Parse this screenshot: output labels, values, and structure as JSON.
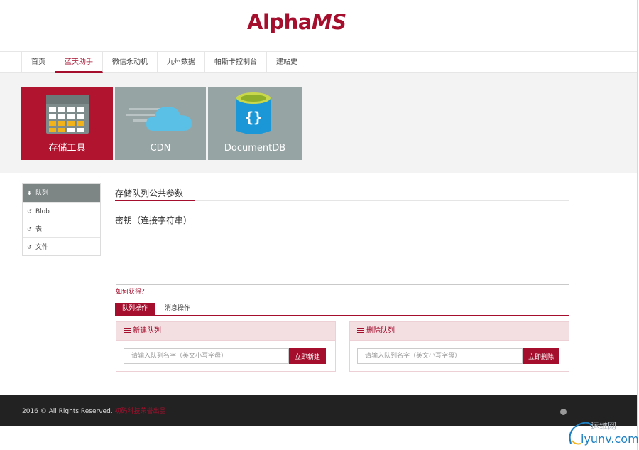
{
  "brand": {
    "name_a": "Alpha",
    "name_b": "MS"
  },
  "nav": {
    "items": [
      {
        "label": "首页"
      },
      {
        "label": "蓝天助手"
      },
      {
        "label": "微信永动机"
      },
      {
        "label": "九州数据"
      },
      {
        "label": "帕斯卡控制台"
      },
      {
        "label": "建站史"
      }
    ],
    "active": "蓝天助手"
  },
  "tiles": [
    {
      "label": "存储工具",
      "icon": "table-icon"
    },
    {
      "label": "CDN",
      "icon": "cloud-icon"
    },
    {
      "label": "DocumentDB",
      "icon": "database-icon"
    }
  ],
  "sidebar": {
    "items": [
      {
        "label": "队列",
        "icon": "download-icon"
      },
      {
        "label": "Blob",
        "icon": "refresh-icon"
      },
      {
        "label": "表",
        "icon": "refresh-icon"
      },
      {
        "label": "文件",
        "icon": "refresh-icon"
      }
    ]
  },
  "main": {
    "section_title": "存储队列公共参数",
    "key_label": "密钥（连接字符串）",
    "key_value": "",
    "howto": "如何获得？",
    "tabs": [
      {
        "label": "队列操作"
      },
      {
        "label": "消息操作"
      }
    ],
    "create_panel": {
      "title": "新建队列",
      "placeholder": "请输入队列名字（英文小写字母）",
      "button": "立即新建"
    },
    "delete_panel": {
      "title": "删除队列",
      "placeholder": "请输入队列名字（英文小写字母）",
      "button": "立即删除"
    }
  },
  "footer": {
    "copyright": "2016 © All Rights Reserved.",
    "credit": "初码科技荣誉出品"
  },
  "watermark": {
    "text_cn": "运维网",
    "text_en": "iyunv.com"
  },
  "colors": {
    "accent": "#a50f2d",
    "tile_gray": "#97a4a4",
    "footer_bg": "#222222"
  }
}
